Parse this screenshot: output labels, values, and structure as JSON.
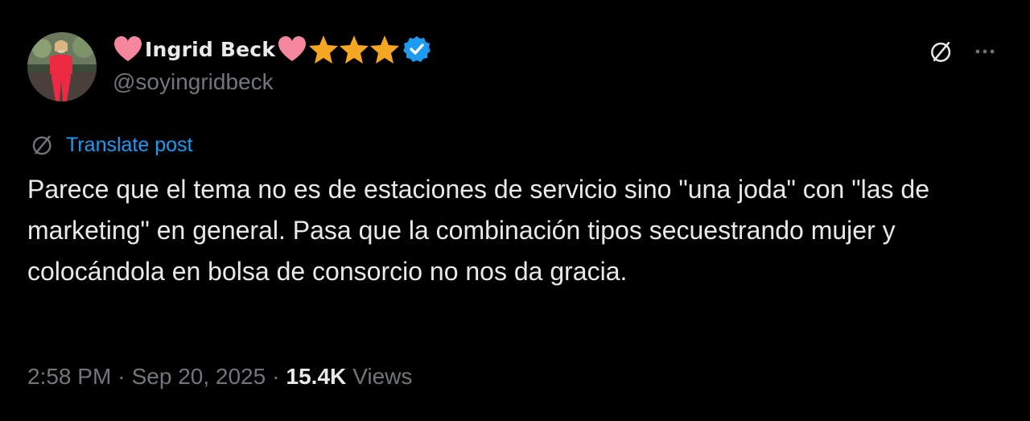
{
  "author": {
    "display_name": "Ingrid Beck",
    "handle": "@soyingridbeck",
    "emoji": [
      "pink-heart-icon",
      "pink-heart-icon",
      "star-icon",
      "star-icon",
      "star-icon"
    ],
    "verified_badge": "verified-icon"
  },
  "header_actions": {
    "grok": "grok-icon",
    "more": "more-icon"
  },
  "translate": {
    "label": "Translate post",
    "icon": "grok-icon"
  },
  "post": {
    "text": "Parece que el tema no es de estaciones de servicio sino \"una joda\" con \"las de marketing\" en general. Pasa que la combinación tipos secuestrando mujer y colocándola en bolsa de consorcio no nos da gracia."
  },
  "meta": {
    "time": "2:58 PM",
    "separator": "·",
    "date": "Sep 20, 2025",
    "views_count": "15.4K",
    "views_label": "Views"
  },
  "colors": {
    "background": "#000000",
    "text_primary": "#e7e9ea",
    "text_secondary": "#71767b",
    "link": "#1d9bf0",
    "verified": "#1d9bf0",
    "heart": "#f4869d",
    "star": "#f5a623"
  }
}
